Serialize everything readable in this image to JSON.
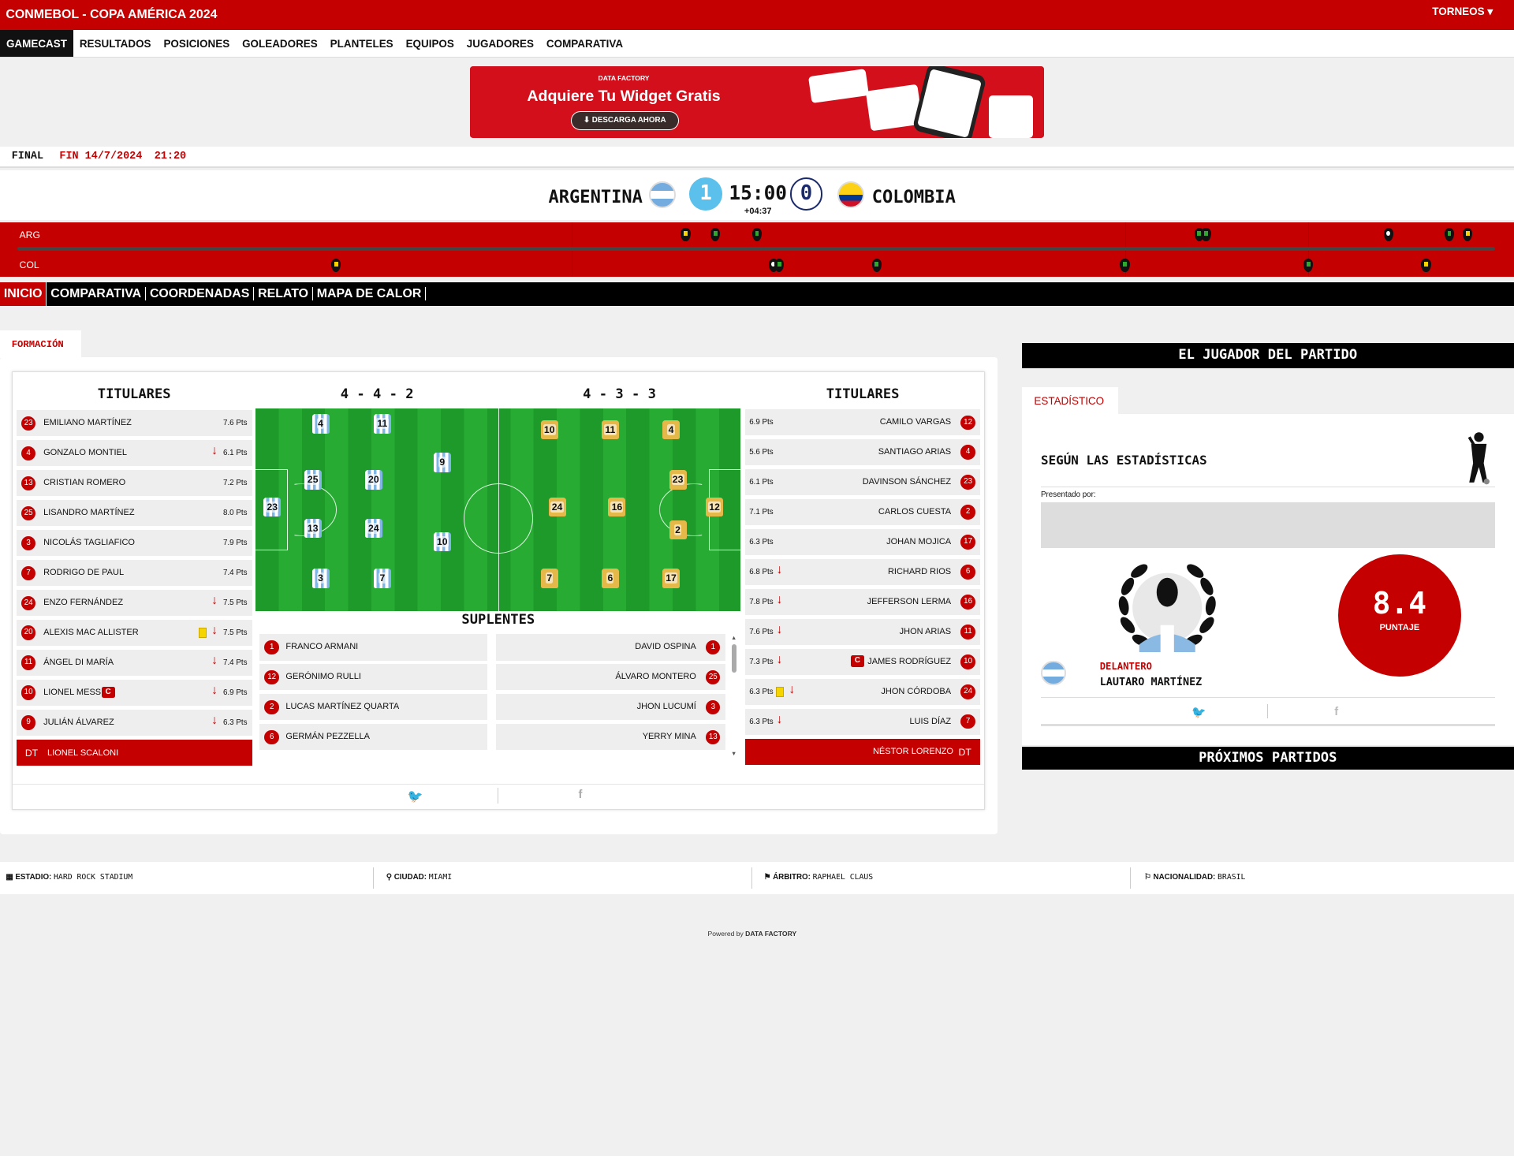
{
  "header": {
    "title": "CONMEBOL - COPA AMÉRICA 2024",
    "torneos": "TORNEOS"
  },
  "nav": [
    "GAMECAST",
    "RESULTADOS",
    "POSICIONES",
    "GOLEADORES",
    "PLANTELES",
    "EQUIPOS",
    "JUGADORES",
    "COMPARATIVA"
  ],
  "banner": {
    "brand": "DATA FACTORY",
    "headline": "Adquiere Tu Widget Gratis",
    "cta": "DESCARGA AHORA"
  },
  "status": {
    "state": "FINAL",
    "detail": "FIN 14/7/2024",
    "time": "21:20"
  },
  "score": {
    "home": "ARGENTINA",
    "away": "COLOMBIA",
    "home_goals": "1",
    "away_goals": "0",
    "clock": "15:00",
    "added": "+04:37"
  },
  "timeline": {
    "home_label": "ARG",
    "away_label": "COL"
  },
  "subnav": [
    "INICIO",
    "COMPARATIVA",
    "COORDENADAS",
    "RELATO",
    "MAPA DE CALOR"
  ],
  "formation": {
    "tab": "FORMACIÓN",
    "home_header": "TITULARES",
    "away_header": "TITULARES",
    "home_system": "4 - 4 - 2",
    "away_system": "4 - 3 - 3",
    "subs_header": "SUPLENTES",
    "home_players": [
      {
        "n": "23",
        "name": "EMILIANO MARTÍNEZ",
        "pts": "7.6 Pts"
      },
      {
        "n": "4",
        "name": "GONZALO MONTIEL",
        "pts": "6.1 Pts"
      },
      {
        "n": "13",
        "name": "CRISTIAN ROMERO",
        "pts": "7.2 Pts"
      },
      {
        "n": "25",
        "name": "LISANDRO MARTÍNEZ",
        "pts": "8.0 Pts"
      },
      {
        "n": "3",
        "name": "NICOLÁS TAGLIAFICO",
        "pts": "7.9 Pts"
      },
      {
        "n": "7",
        "name": "RODRIGO DE PAUL",
        "pts": "7.4 Pts"
      },
      {
        "n": "24",
        "name": "ENZO FERNÁNDEZ",
        "pts": "7.5 Pts"
      },
      {
        "n": "20",
        "name": "ALEXIS MAC ALLISTER",
        "pts": "7.5 Pts"
      },
      {
        "n": "11",
        "name": "ÁNGEL DI MARÍA",
        "pts": "7.4 Pts"
      },
      {
        "n": "10",
        "name": "LIONEL MESSI",
        "pts": "6.9 Pts",
        "captain": "C"
      },
      {
        "n": "9",
        "name": "JULIÁN ÁLVAREZ",
        "pts": "6.3 Pts"
      }
    ],
    "away_players": [
      {
        "n": "12",
        "name": "CAMILO VARGAS",
        "pts": "6.9 Pts"
      },
      {
        "n": "4",
        "name": "SANTIAGO ARIAS",
        "pts": "5.6 Pts"
      },
      {
        "n": "23",
        "name": "DAVINSON SÁNCHEZ",
        "pts": "6.1 Pts"
      },
      {
        "n": "2",
        "name": "CARLOS CUESTA",
        "pts": "7.1 Pts"
      },
      {
        "n": "17",
        "name": "JOHAN MOJICA",
        "pts": "6.3 Pts"
      },
      {
        "n": "6",
        "name": "RICHARD RIOS",
        "pts": "6.8 Pts"
      },
      {
        "n": "16",
        "name": "JEFFERSON LERMA",
        "pts": "7.8 Pts"
      },
      {
        "n": "11",
        "name": "JHON ARIAS",
        "pts": "7.6 Pts"
      },
      {
        "n": "10",
        "name": "JAMES RODRÍGUEZ",
        "pts": "7.3 Pts",
        "captain": "C"
      },
      {
        "n": "24",
        "name": "JHON CÓRDOBA",
        "pts": "6.3 Pts"
      },
      {
        "n": "7",
        "name": "LUIS DÍAZ",
        "pts": "6.3 Pts"
      }
    ],
    "home_coach": {
      "label": "DT",
      "name": "LIONEL SCALONI"
    },
    "away_coach": {
      "label": "DT",
      "name": "NÉSTOR LORENZO"
    },
    "home_subs": [
      {
        "n": "1",
        "name": "FRANCO ARMANI"
      },
      {
        "n": "12",
        "name": "GERÓNIMO RULLI"
      },
      {
        "n": "2",
        "name": "LUCAS MARTÍNEZ QUARTA"
      },
      {
        "n": "6",
        "name": "GERMÁN PEZZELLA"
      }
    ],
    "away_subs": [
      {
        "n": "1",
        "name": "DAVID OSPINA"
      },
      {
        "n": "25",
        "name": "ÁLVARO MONTERO"
      },
      {
        "n": "3",
        "name": "JHON LUCUMÍ"
      },
      {
        "n": "13",
        "name": "YERRY MINA"
      }
    ]
  },
  "potm": {
    "title": "EL JUGADOR DEL PARTIDO",
    "tab": "ESTADÍSTICO",
    "subtitle": "SEGÚN LAS ESTADÍSTICAS",
    "presented": "Presentado por:",
    "position": "DELANTERO",
    "player": "LAUTARO MARTÍNEZ",
    "rating": "8.4",
    "rating_label": "PUNTAJE"
  },
  "proximos": "PRÓXIMOS PARTIDOS",
  "footer": {
    "estadio_label": "ESTADIO:",
    "estadio": "HARD ROCK STADIUM",
    "ciudad_label": "CIUDAD:",
    "ciudad": "MIAMI",
    "arbitro_label": "ÁRBITRO:",
    "arbitro": "RAPHAEL CLAUS",
    "nac_label": "NACIONALIDAD:",
    "nac": "BRASIL",
    "powered": "Powered by",
    "powered_brand": "DATA FACTORY"
  },
  "colors": {
    "brand_red": "#c40000",
    "home_goal_bg": "#5bc0eb",
    "away_goal_border": "#1a2a6c"
  }
}
